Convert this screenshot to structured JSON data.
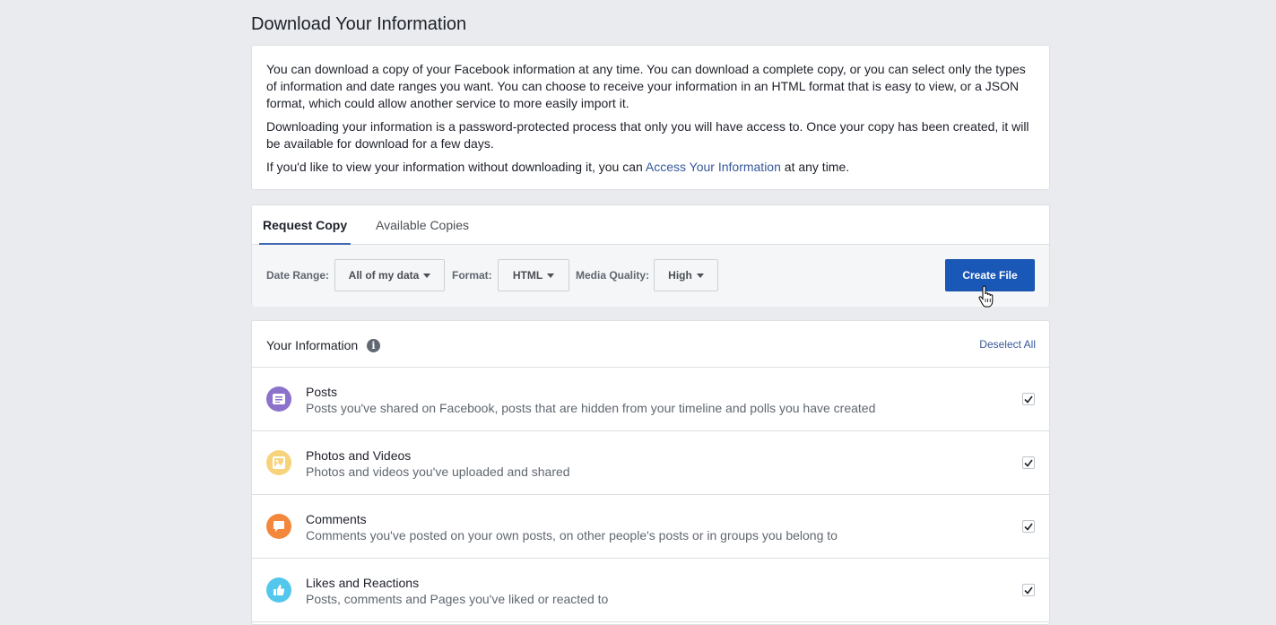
{
  "page": {
    "title": "Download Your Information"
  },
  "intro": {
    "p1": "You can download a copy of your Facebook information at any time. You can download a complete copy, or you can select only the types of information and date ranges you want. You can choose to receive your information in an HTML format that is easy to view, or a JSON format, which could allow another service to more easily import it.",
    "p2": "Downloading your information is a password-protected process that only you will have access to. Once your copy has been created, it will be available for download for a few days.",
    "p3_before": "If you'd like to view your information without downloading it, you can ",
    "p3_link": "Access Your Information",
    "p3_after": " at any time."
  },
  "tabs": [
    {
      "label": "Request Copy",
      "active": true
    },
    {
      "label": "Available Copies",
      "active": false
    }
  ],
  "options": {
    "date_range_label": "Date Range:",
    "date_range_value": "All of my data",
    "format_label": "Format:",
    "format_value": "HTML",
    "media_quality_label": "Media Quality:",
    "media_quality_value": "High",
    "create_button": "Create File"
  },
  "your_information": {
    "title": "Your Information",
    "info_icon_glyph": "i",
    "deselect_label": "Deselect All",
    "items": [
      {
        "title": "Posts",
        "description": "Posts you've shared on Facebook, posts that are hidden from your timeline and polls you have created",
        "icon": "posts-icon",
        "color": "#8c72cb",
        "checked": true
      },
      {
        "title": "Photos and Videos",
        "description": "Photos and videos you've uploaded and shared",
        "icon": "photo-icon",
        "color": "#f7d37c",
        "checked": true
      },
      {
        "title": "Comments",
        "description": "Comments you've posted on your own posts, on other people's posts or in groups you belong to",
        "icon": "comment-icon",
        "color": "#f3883d",
        "checked": true
      },
      {
        "title": "Likes and Reactions",
        "description": "Posts, comments and Pages you've liked or reacted to",
        "icon": "like-icon",
        "color": "#54c7ec",
        "checked": true
      }
    ]
  },
  "colors": {
    "accent": "#4267b2",
    "button": "#1a58b7",
    "link": "#365899",
    "background": "#e9ebee"
  }
}
